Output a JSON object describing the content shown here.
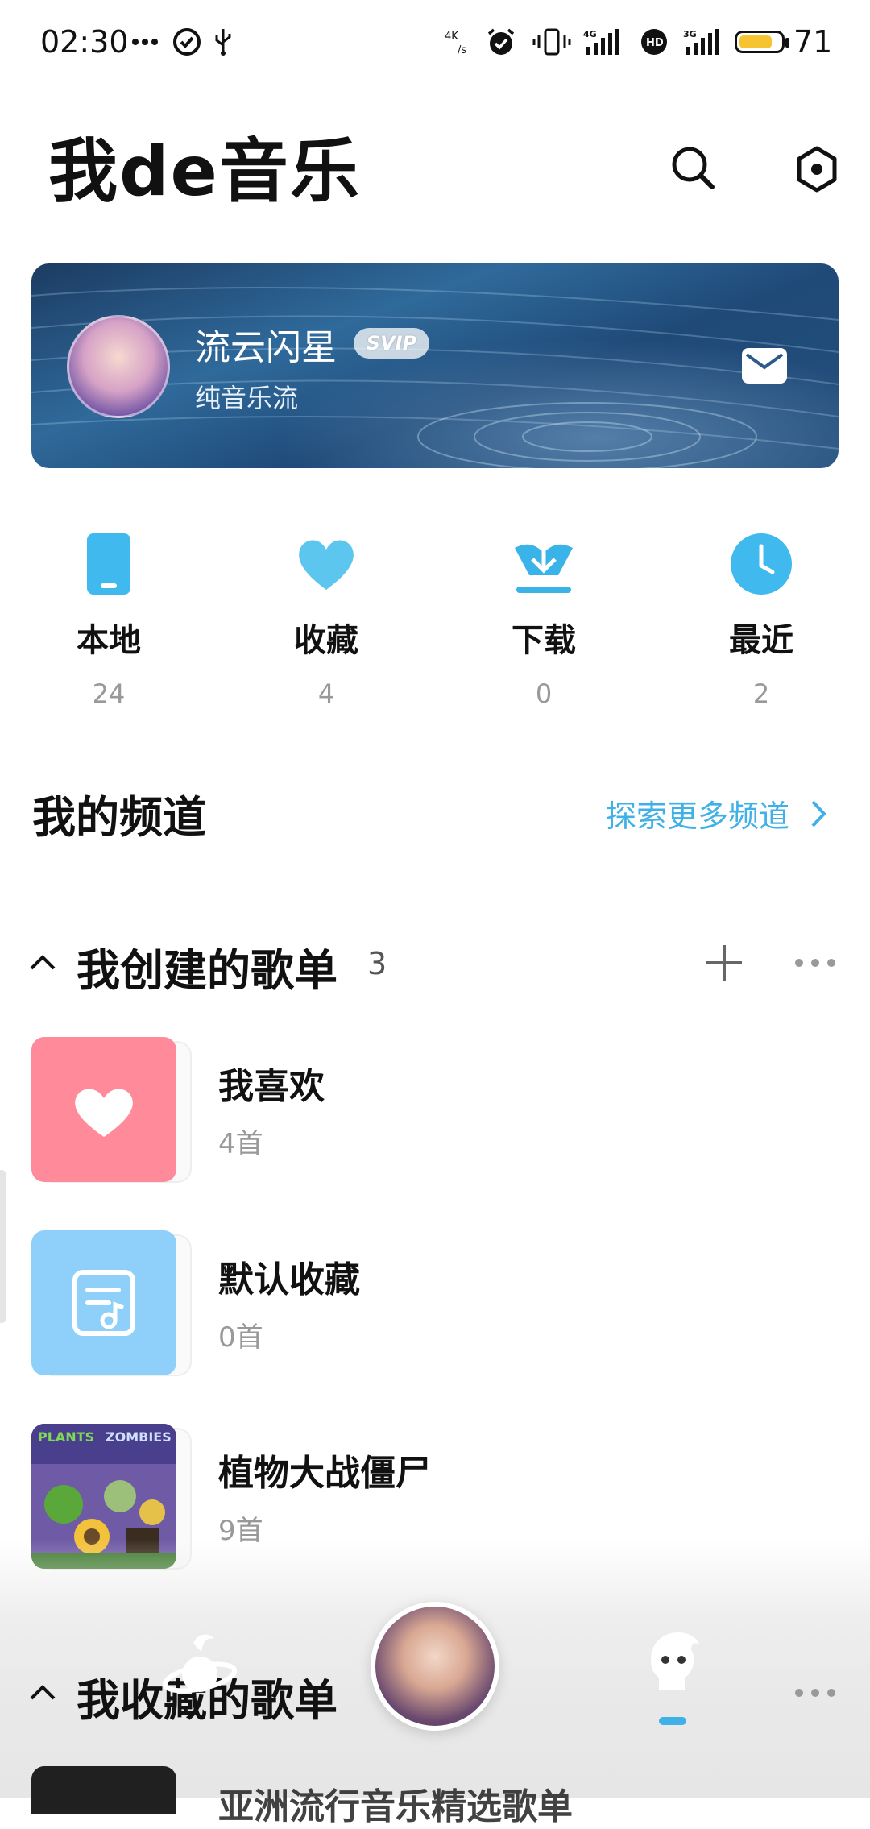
{
  "status_bar": {
    "time": "02:30",
    "icons": [
      "more-dots-icon",
      "check-circle-icon",
      "usb-icon",
      "network-speed-icon",
      "alarm-icon",
      "vibrate-icon",
      "signal-4g-icon",
      "hd-icon",
      "signal-3g-icon",
      "battery-icon"
    ],
    "battery_level": "71"
  },
  "header": {
    "title": "我de音乐"
  },
  "profile": {
    "name": "流云闪星",
    "badge": "SVIP",
    "subtitle": "纯音乐流"
  },
  "quick_stats": [
    {
      "label": "本地",
      "count": "24",
      "icon": "phone-icon",
      "color": "#3fb9ee"
    },
    {
      "label": "收藏",
      "count": "4",
      "icon": "heart-icon",
      "color": "#5cc6ef"
    },
    {
      "label": "下载",
      "count": "0",
      "icon": "download-icon",
      "color": "#39b3e8"
    },
    {
      "label": "最近",
      "count": "2",
      "icon": "clock-icon",
      "color": "#3fb9ee"
    }
  ],
  "channels": {
    "title": "我的频道",
    "explore_label": "探索更多频道"
  },
  "created_playlists": {
    "title": "我创建的歌单",
    "count": "3",
    "items": [
      {
        "name": "我喜欢",
        "count": "4首",
        "cover": "heart-cover",
        "color": "#ff8b9a"
      },
      {
        "name": "默认收藏",
        "count": "0首",
        "cover": "music-note-cover",
        "color": "#8fd0fa"
      },
      {
        "name": "植物大战僵尸",
        "count": "9首",
        "cover": "album-art-cover"
      }
    ]
  },
  "collected_playlists": {
    "title": "我收藏的歌单",
    "next_item_title": "亚洲流行音乐精选歌单"
  },
  "bottom_nav": {
    "items": [
      "planet-icon",
      "now-playing-avatar",
      "mine-icon"
    ],
    "active": "mine-icon"
  },
  "colors": {
    "accent": "#3fb1e6"
  }
}
